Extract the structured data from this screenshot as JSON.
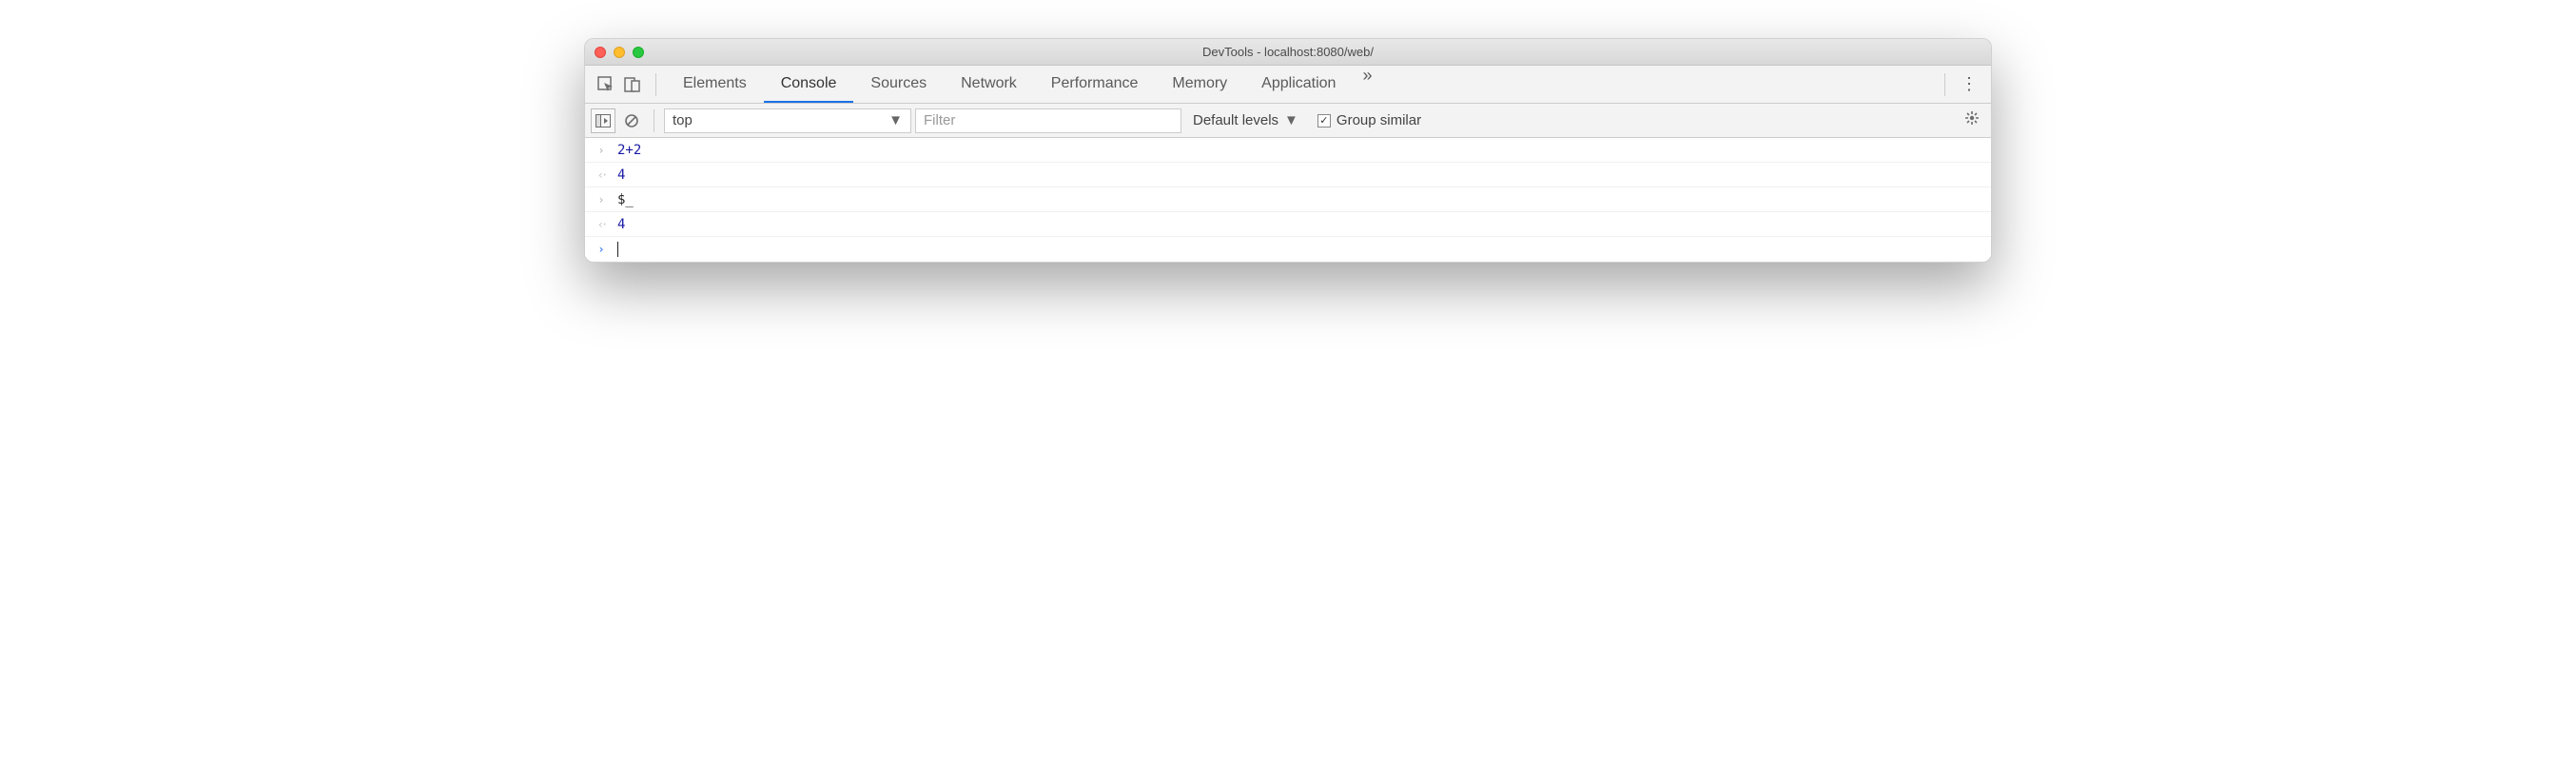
{
  "window": {
    "title": "DevTools - localhost:8080/web/"
  },
  "tabs": {
    "items": [
      "Elements",
      "Console",
      "Sources",
      "Network",
      "Performance",
      "Memory",
      "Application"
    ],
    "active_index": 1
  },
  "toolbar": {
    "context_selected": "top",
    "filter_placeholder": "Filter",
    "filter_value": "",
    "levels_label": "Default levels",
    "group_similar_label": "Group similar",
    "group_similar_checked": true
  },
  "console": {
    "entries": [
      {
        "kind": "input",
        "text": "2+2"
      },
      {
        "kind": "output",
        "text": "4"
      },
      {
        "kind": "input",
        "text": "$_"
      },
      {
        "kind": "output",
        "text": "4"
      }
    ]
  }
}
